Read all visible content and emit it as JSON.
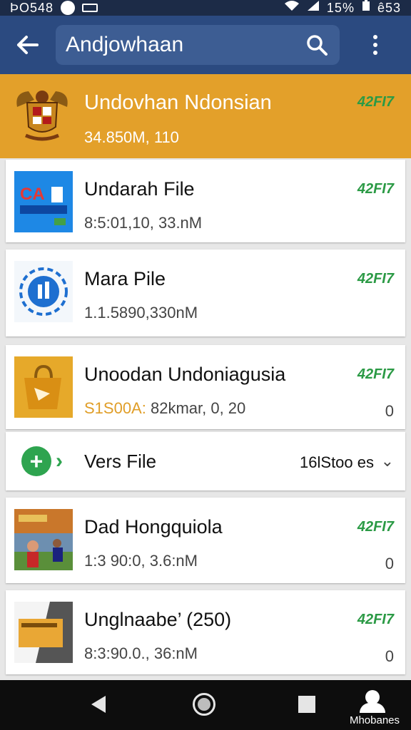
{
  "status_bar": {
    "left_text": "ÞO548",
    "right_text": "15%",
    "time": "ê53"
  },
  "app_bar": {
    "search_value": "Andjowhaan"
  },
  "featured": {
    "title": "Undovhan Ndonsian",
    "subtitle": "34.850M, 110",
    "tag": "42FI7"
  },
  "items": [
    {
      "title": "Undarah File",
      "subtitle": "8:5:01,10, 33.nM",
      "tag": "42FI7",
      "count": ""
    },
    {
      "title": "Mara Pile",
      "subtitle": "1.1.5890,330nM",
      "tag": "42FI7",
      "count": ""
    },
    {
      "title": "Unoodan Undoniagusia",
      "subtitle_accent": "S1S00A:",
      "subtitle": "82kmar, 0, 20",
      "tag": "42FI7",
      "count": "0"
    },
    {
      "title": "Dad Hongquiola",
      "subtitle": "1:3 90:0, 3.6:nM",
      "tag": "42FI7",
      "count": "0"
    },
    {
      "title": "Unglnaabe’ (250)",
      "subtitle": "8:3:90.0., 36:nM",
      "tag": "42FI7",
      "count": "0"
    }
  ],
  "versions_row": {
    "label": "Vers File",
    "count": "16lStoo es"
  },
  "nav_bar": {
    "profile_label": "Mhobanes"
  },
  "colors": {
    "app_bar": "#2b4a80",
    "featured_bg": "#e3a02a",
    "tag_green": "#2b9a45"
  }
}
